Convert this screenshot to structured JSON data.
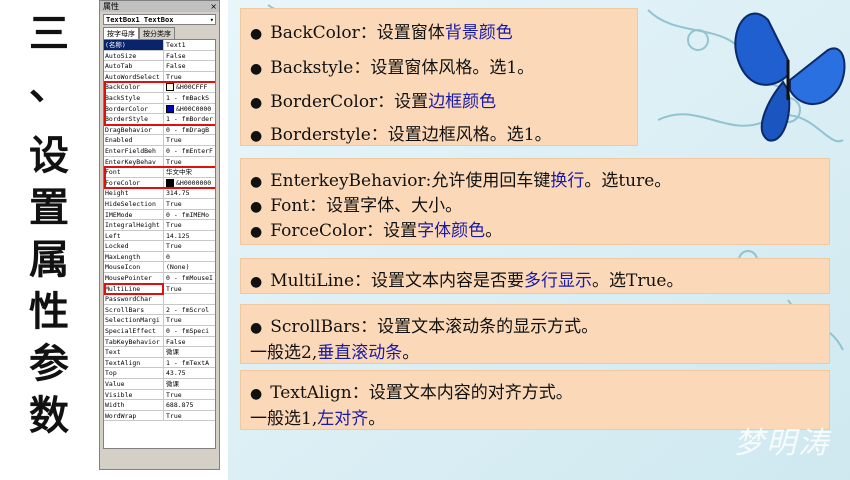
{
  "title_chars": [
    "三",
    "、",
    "设",
    "置",
    "属",
    "性",
    "参",
    "数"
  ],
  "props_window": {
    "title": "属性",
    "close": "×",
    "object_selector": "TextBox1 TextBox",
    "tabs": [
      "按字母序",
      "按分类序"
    ],
    "rows": [
      {
        "name": "(名称)",
        "value": "Text1"
      },
      {
        "name": "AutoSize",
        "value": "False"
      },
      {
        "name": "AutoTab",
        "value": "False"
      },
      {
        "name": "AutoWordSelect",
        "value": "True"
      },
      {
        "name": "BackColor",
        "value": "&H00CFFF"
      },
      {
        "name": "BackStyle",
        "value": "1 - fmBackS"
      },
      {
        "name": "BorderColor",
        "value": "&H00C0000"
      },
      {
        "name": "BorderStyle",
        "value": "1 - fmBorder"
      },
      {
        "name": "DragBehavior",
        "value": "0 - fmDragB"
      },
      {
        "name": "Enabled",
        "value": "True"
      },
      {
        "name": "EnterFieldBeh",
        "value": "0 - fmEnterF"
      },
      {
        "name": "EnterKeyBehav",
        "value": "True"
      },
      {
        "name": "Font",
        "value": "华文中宋"
      },
      {
        "name": "ForeColor",
        "value": "&H0000000"
      },
      {
        "name": "Height",
        "value": "314.75"
      },
      {
        "name": "HideSelection",
        "value": "True"
      },
      {
        "name": "IMEMode",
        "value": "0 - fmIMEMo"
      },
      {
        "name": "IntegralHeight",
        "value": "True"
      },
      {
        "name": "Left",
        "value": "14.125"
      },
      {
        "name": "Locked",
        "value": "True"
      },
      {
        "name": "MaxLength",
        "value": "0"
      },
      {
        "name": "MouseIcon",
        "value": "(None)"
      },
      {
        "name": "MousePointer",
        "value": "0 - fmMouseI"
      },
      {
        "name": "MultiLine",
        "value": "True"
      },
      {
        "name": "PasswordChar",
        "value": ""
      },
      {
        "name": "ScrollBars",
        "value": "2 - fmScrol"
      },
      {
        "name": "SelectionMargi",
        "value": "True"
      },
      {
        "name": "SpecialEffect",
        "value": "0 - fmSpeci"
      },
      {
        "name": "TabKeyBehavior",
        "value": "False"
      },
      {
        "name": "Text",
        "value": "微课"
      },
      {
        "name": "TextAlign",
        "value": "1 - fmTextA"
      },
      {
        "name": "Top",
        "value": "43.75"
      },
      {
        "name": "Value",
        "value": "微课"
      },
      {
        "name": "Visible",
        "value": "True"
      },
      {
        "name": "Width",
        "value": "688.875"
      },
      {
        "name": "WordWrap",
        "value": "True"
      }
    ],
    "colors": {
      "backcolor_swatch": "#fff8e0",
      "bordercolor_swatch": "#0000c0",
      "forecolor_swatch": "#000000",
      "highlight": "#e01010"
    }
  },
  "content": {
    "box1": [
      {
        "pre": "BackColor：设置窗体",
        "em": "背景颜色",
        "post": ""
      },
      {
        "pre": "Backstyle：设置窗体风格。选1。",
        "em": "",
        "post": ""
      },
      {
        "pre": "BorderColor：设置",
        "em": "边框颜色",
        "post": ""
      },
      {
        "pre": "Borderstyle：设置边框风格。选1。",
        "em": "",
        "post": ""
      }
    ],
    "box2": [
      {
        "pre": "EnterkeyBehavior:允许使用回车键",
        "em": "换行",
        "post": "。选ture。"
      },
      {
        "pre": "Font：设置字体、大小。",
        "em": "",
        "post": ""
      },
      {
        "pre": "ForceColor：设置",
        "em": "字体颜色",
        "post": "。"
      }
    ],
    "box3": [
      {
        "pre": "MultiLine：设置文本内容是否要",
        "em": "多行显示",
        "post": "。选True。"
      }
    ],
    "box4": {
      "line1": "ScrollBars：设置文本滚动条的显示方式。",
      "line2_pre": "一般选2,",
      "line2_em": "垂直滚动条",
      "line2_post": "。"
    },
    "box5": {
      "line1": "TextAlign：设置文本内容的对齐方式。",
      "line2_pre": "一般选1,",
      "line2_em": "左对齐",
      "line2_post": "。"
    },
    "bullet": "●",
    "watermark": "梦明涛",
    "colors": {
      "box_bg": "#fbd9b8",
      "emphasis": "#1a1aa8",
      "bg": "#dff0f6",
      "butterfly": "#1f5fd0"
    }
  }
}
